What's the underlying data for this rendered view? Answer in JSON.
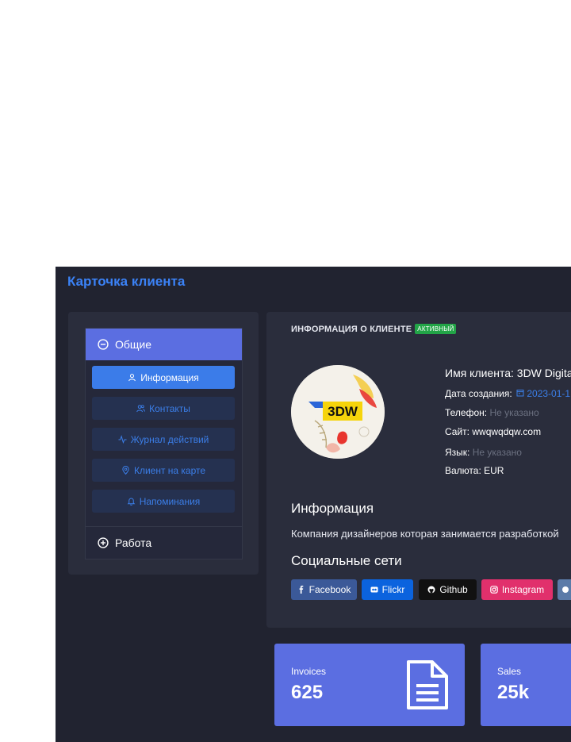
{
  "page": {
    "title": "Карточка клиента"
  },
  "menu": {
    "general_label": "Общие",
    "work_label": "Работа",
    "items": [
      {
        "label": "Информация",
        "icon": "user-icon",
        "active": true
      },
      {
        "label": "Контакты",
        "icon": "users-icon",
        "active": false
      },
      {
        "label": "Журнал действий",
        "icon": "activity-icon",
        "active": false
      },
      {
        "label": "Клиент на карте",
        "icon": "map-pin-icon",
        "active": false
      },
      {
        "label": "Напоминания",
        "icon": "bell-icon",
        "active": false
      }
    ]
  },
  "client": {
    "header": "ИНФОРМАЦИЯ О КЛИЕНТЕ",
    "status_badge": "АКТИВНЫЙ",
    "avatar_text": "3DW",
    "name_label": "Имя клиента:",
    "name_value": "3DW Digita",
    "created_label": "Дата создания:",
    "created_value": "2023-01-1",
    "phone_label": "Телефон:",
    "phone_value": "Не указано",
    "site_label": "Сайт:",
    "site_value": "wwqwqdqw.com",
    "language_label": "Язык:",
    "language_value": "Не указано",
    "currency_label": "Валюта:",
    "currency_value": "EUR",
    "info_title": "Информация",
    "description": "Компания дизайнеров которая занимается разработкой",
    "social_title": "Социальные сети",
    "socials": [
      {
        "label": "Facebook",
        "color": "#3b5998"
      },
      {
        "label": "Flickr",
        "color": "#0b63de"
      },
      {
        "label": "Github",
        "color": "#111111"
      },
      {
        "label": "Instagram",
        "color": "#e1306c"
      }
    ]
  },
  "stats": [
    {
      "label": "Invoices",
      "value": "625",
      "icon": "document-icon"
    },
    {
      "label": "Sales",
      "value": "25k"
    }
  ]
}
